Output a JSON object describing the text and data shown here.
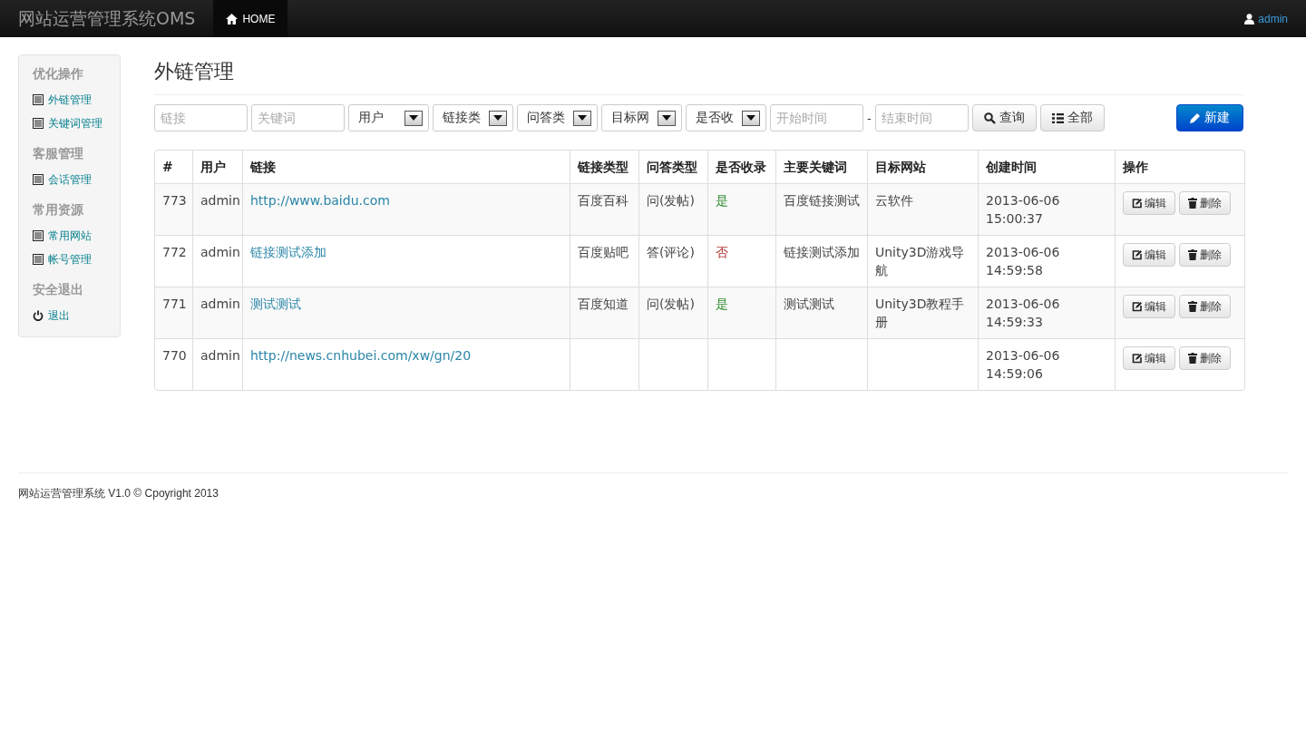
{
  "navbar": {
    "brand": "网站运营管理系统OMS",
    "nav": [
      {
        "label": "HOME",
        "selected": true
      }
    ],
    "user": "admin"
  },
  "sidebar": {
    "groups": [
      {
        "title": "优化操作",
        "items": [
          {
            "label": "外链管理",
            "kind": "list"
          },
          {
            "label": "关键词管理",
            "kind": "list"
          }
        ]
      },
      {
        "title": "客服管理",
        "items": [
          {
            "label": "会话管理",
            "kind": "list"
          }
        ]
      },
      {
        "title": "常用资源",
        "items": [
          {
            "label": "常用网站",
            "kind": "list"
          },
          {
            "label": "帐号管理",
            "kind": "list"
          }
        ]
      },
      {
        "title": "安全退出",
        "items": [
          {
            "label": "退出",
            "kind": "power"
          }
        ]
      }
    ]
  },
  "page_title": "外链管理",
  "filters": [
    {
      "kind": "input",
      "placeholder": "链接"
    },
    {
      "kind": "input",
      "placeholder": "关键词"
    },
    {
      "kind": "select",
      "value": "用户"
    },
    {
      "kind": "select",
      "value": "链接类"
    },
    {
      "kind": "select",
      "value": "问答类"
    },
    {
      "kind": "select",
      "value": "目标网"
    },
    {
      "kind": "select",
      "value": "是否收"
    },
    {
      "kind": "input",
      "placeholder": "开始时间"
    },
    {
      "kind": "dash",
      "text": "-"
    },
    {
      "kind": "input",
      "placeholder": "结束时间"
    }
  ],
  "actions": [
    {
      "kind": "search",
      "label": "查询"
    },
    {
      "kind": "list",
      "label": "全部"
    }
  ],
  "new_button": "新建",
  "table": {
    "columns": [
      "#",
      "用户",
      "链接",
      "链接类型",
      "问答类型",
      "是否收录",
      "主要关键词",
      "目标网站",
      "创建时间",
      "操作"
    ],
    "rows": [
      {
        "id": "773",
        "user": "admin",
        "link": "http://www.baidu.com",
        "link_type": "百度百科",
        "qa_type": "问(发帖)",
        "indexed": "是",
        "is_indexed": true,
        "keyword": "百度链接测试",
        "site": "云软件",
        "created": "2013-06-06 15:00:37",
        "edit": "编辑",
        "delete": "删除"
      },
      {
        "id": "772",
        "user": "admin",
        "link": "链接测试添加",
        "link_type": "百度贴吧",
        "qa_type": "答(评论)",
        "indexed": "否",
        "is_indexed": false,
        "keyword": "链接测试添加",
        "site": "Unity3D游戏导航",
        "created": "2013-06-06 14:59:58",
        "edit": "编辑",
        "delete": "删除"
      },
      {
        "id": "771",
        "user": "admin",
        "link": "测试测试",
        "link_type": "百度知道",
        "qa_type": "问(发帖)",
        "indexed": "是",
        "is_indexed": true,
        "keyword": "测试测试",
        "site": "Unity3D教程手册",
        "created": "2013-06-06 14:59:33",
        "edit": "编辑",
        "delete": "删除"
      },
      {
        "id": "770",
        "user": "admin",
        "link": "http://news.cnhubei.com/xw/gn/20",
        "created": "2013-06-06 14:59:06",
        "edit": "编辑",
        "delete": "删除"
      }
    ]
  },
  "footer": {
    "brand": "网站运营管理系统",
    "rest": "V1.0 © Cpoyright 2013"
  }
}
